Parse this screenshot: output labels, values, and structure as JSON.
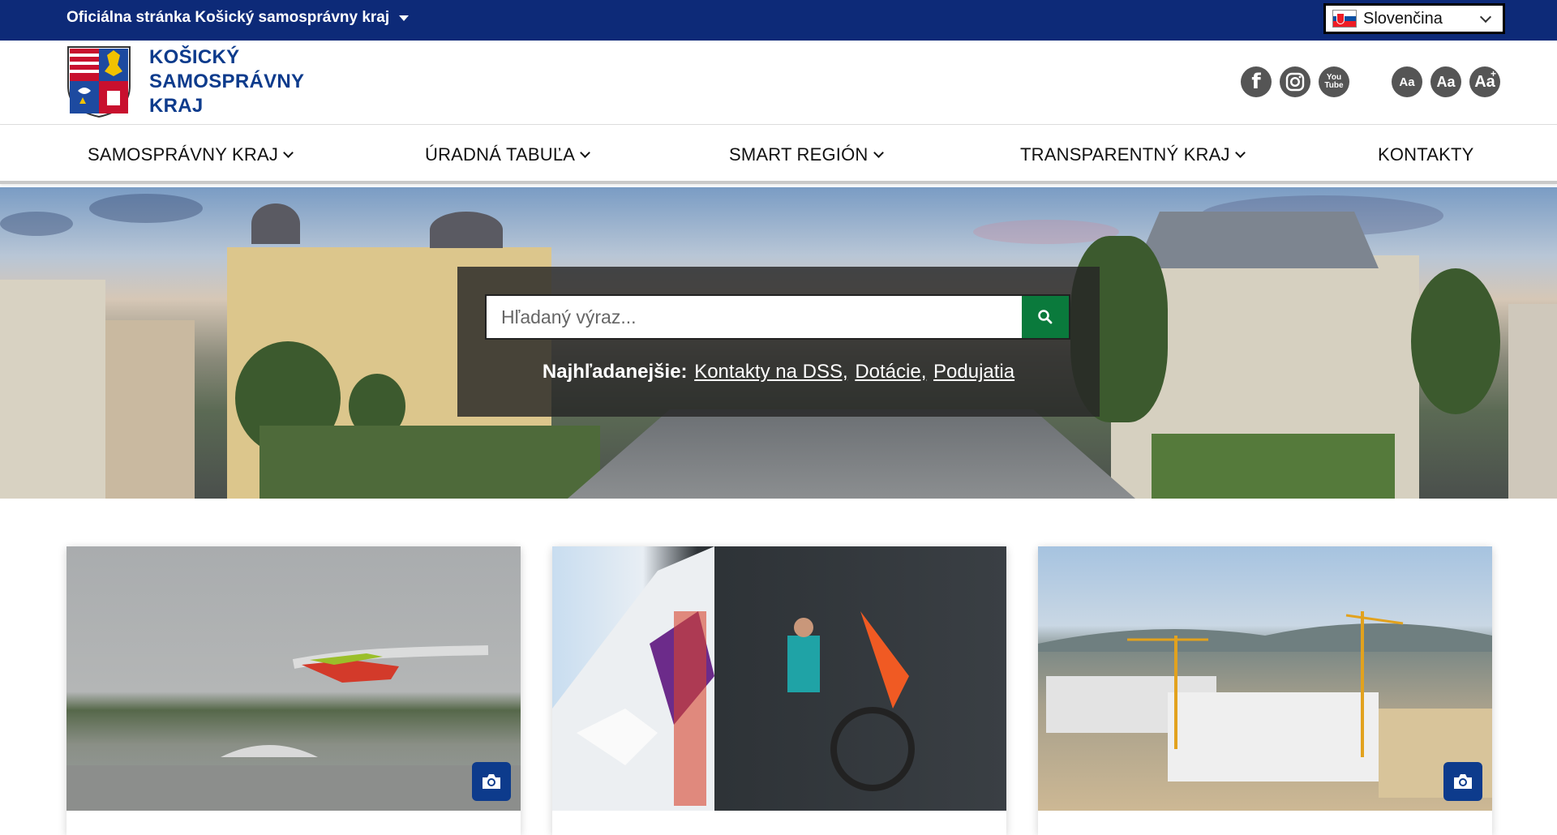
{
  "topbar": {
    "official_label": "Oficiálna stránka Košický samosprávny kraj",
    "language": "Slovenčina"
  },
  "header": {
    "logo_lines": [
      "KOŠICKÝ",
      "SAMOSPRÁVNY",
      "KRAJ"
    ],
    "social": [
      {
        "icon": "facebook-icon",
        "glyph": "f"
      },
      {
        "icon": "instagram-icon",
        "glyph": "◎"
      },
      {
        "icon": "youtube-icon",
        "glyph": "You Tube"
      }
    ],
    "font_size": [
      {
        "icon": "font-decrease-icon",
        "label": "Aa"
      },
      {
        "icon": "font-reset-icon",
        "label": "Aa"
      },
      {
        "icon": "font-increase-icon",
        "label": "Aa"
      }
    ]
  },
  "nav": {
    "items": [
      {
        "label": "SAMOSPRÁVNY KRAJ",
        "dropdown": true
      },
      {
        "label": "ÚRADNÁ TABUĽA",
        "dropdown": true
      },
      {
        "label": "SMART REGIÓN",
        "dropdown": true
      },
      {
        "label": "TRANSPARENTNÝ KRAJ",
        "dropdown": true
      },
      {
        "label": "KONTAKTY",
        "dropdown": false
      }
    ]
  },
  "search": {
    "placeholder": "Hľadaný výraz...",
    "popular_label": "Najhľadanejšie:",
    "popular_links": [
      "Kontakty na DSS,",
      "Dotácie,",
      "Podujatia"
    ]
  },
  "colors": {
    "topbar": "#0d2a78",
    "brand_blue": "#0d3b8c",
    "search_button": "#0a7a3c"
  },
  "cards": [
    {
      "image": "airshow-plane",
      "has_gallery_icon": true
    },
    {
      "image": "bus-bicycles",
      "has_gallery_icon": false
    },
    {
      "image": "hospital-construction",
      "has_gallery_icon": true
    }
  ]
}
